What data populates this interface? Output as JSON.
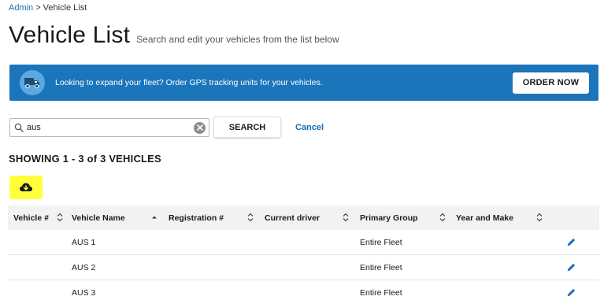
{
  "breadcrumb": {
    "parent": "Admin",
    "separator": ">",
    "current": "Vehicle List"
  },
  "header": {
    "title": "Vehicle List",
    "subtitle": "Search and edit your vehicles from the list below"
  },
  "banner": {
    "icon": "truck-icon",
    "text": "Looking to expand your fleet? Order GPS tracking units for your vehicles.",
    "button_label": "ORDER NOW",
    "background_color": "#1b75bb"
  },
  "search": {
    "value": "aus",
    "placeholder": "",
    "button_label": "SEARCH",
    "cancel_label": "Cancel"
  },
  "results": {
    "showing_text": "SHOWING 1 - 3 of 3 VEHICLES"
  },
  "toolbar": {
    "download_icon": "cloud-download-icon",
    "highlight_color": "#ffff3c"
  },
  "table": {
    "columns": [
      "Vehicle #",
      "Vehicle Name",
      "Registration #",
      "Current driver",
      "Primary Group",
      "Year and Make"
    ],
    "sorted_column": "Vehicle Name",
    "rows": [
      {
        "vehicle_number": "",
        "vehicle_name": "AUS 1",
        "registration": "",
        "current_driver": "",
        "primary_group": "Entire Fleet",
        "year_make": ""
      },
      {
        "vehicle_number": "",
        "vehicle_name": "AUS 2",
        "registration": "",
        "current_driver": "",
        "primary_group": "Entire Fleet",
        "year_make": ""
      },
      {
        "vehicle_number": "",
        "vehicle_name": "AUS 3",
        "registration": "",
        "current_driver": "",
        "primary_group": "Entire Fleet",
        "year_make": ""
      }
    ]
  },
  "colors": {
    "link": "#1a6fb5",
    "header_bg": "#f2f2f2"
  }
}
